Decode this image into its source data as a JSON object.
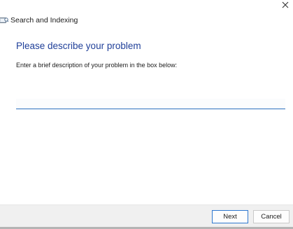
{
  "window": {
    "title": "Search and Indexing",
    "icon": "search-indexing-icon",
    "close_icon": "close-icon"
  },
  "main": {
    "heading": "Please describe your problem",
    "description": "Enter a brief description of your problem in the box below:",
    "problem_input": {
      "value": "",
      "placeholder": ""
    }
  },
  "footer": {
    "next_label": "Next",
    "cancel_label": "Cancel"
  },
  "colors": {
    "heading": "#1f3f99",
    "accent": "#2f78d0",
    "footer_background": "#f0f0f0"
  }
}
